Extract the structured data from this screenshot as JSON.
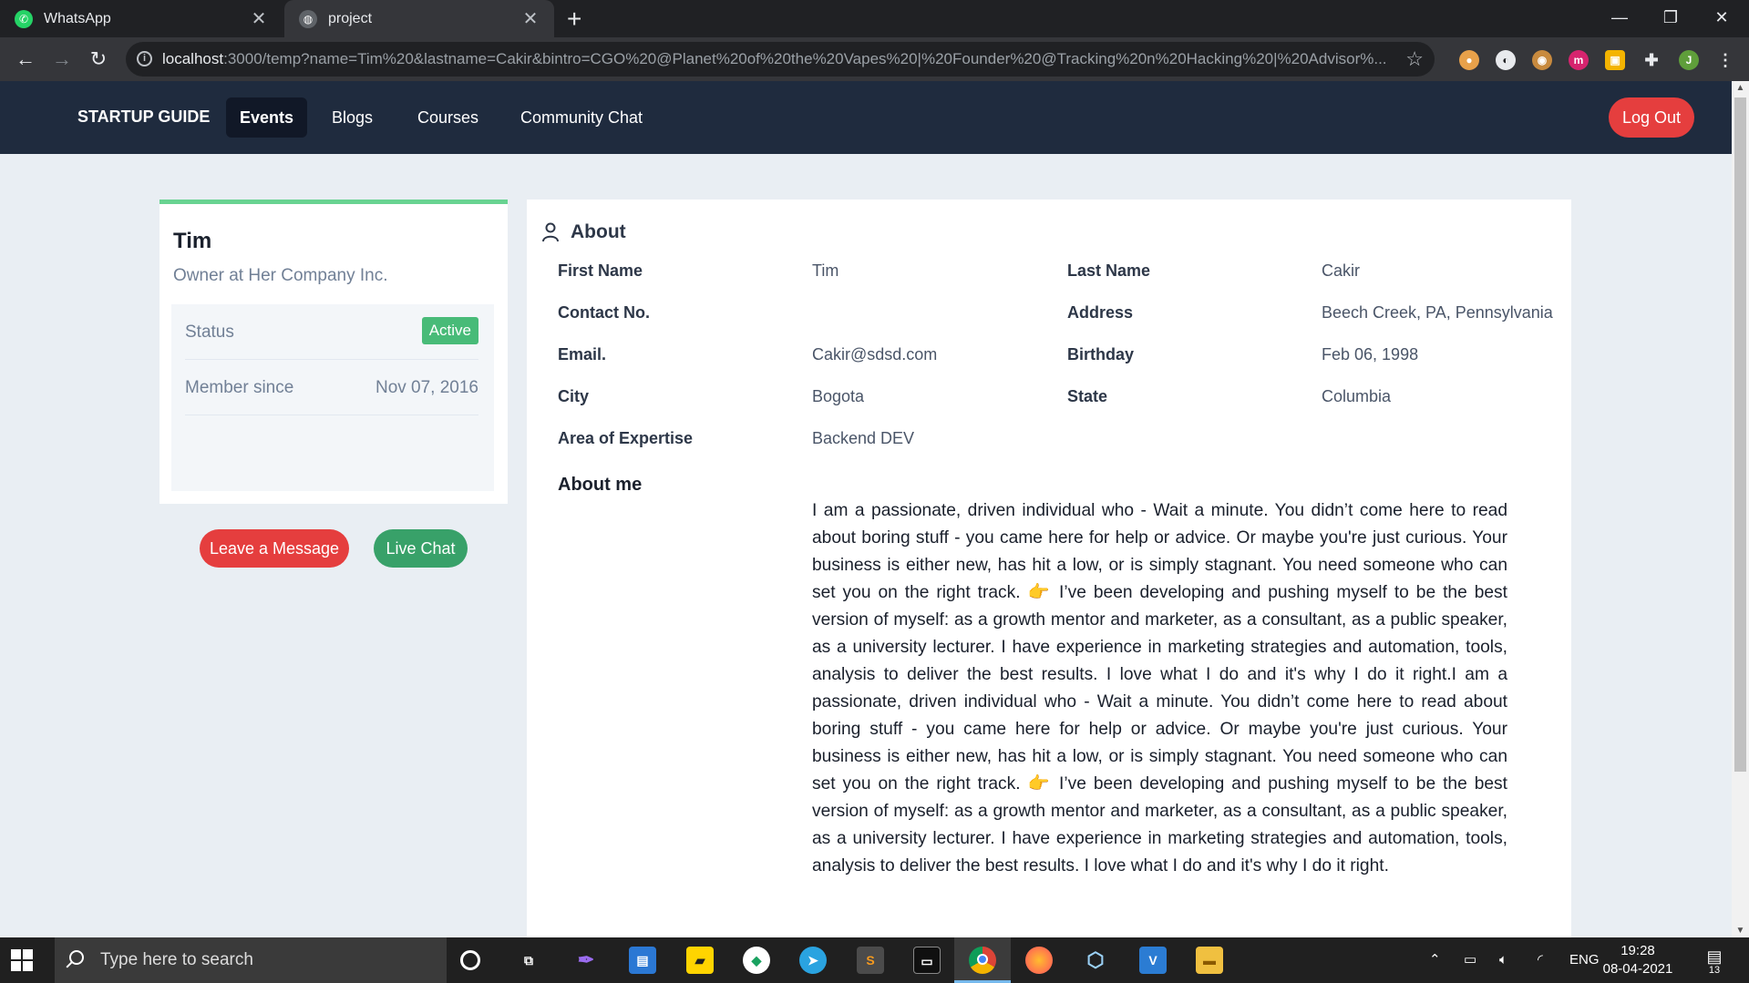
{
  "browser": {
    "tabs": [
      {
        "title": "WhatsApp",
        "icon": "whatsapp-icon"
      },
      {
        "title": "project",
        "icon": "globe-icon"
      }
    ],
    "url_host": "localhost",
    "url_rest": ":3000/temp?name=Tim%20&lastname=Cakir&bintro=CGO%20@Planet%20of%20the%20Vapes%20|%20Founder%20@Tracking%20n%20Hacking%20|%20Advisor%...",
    "profile_initial": "J"
  },
  "nav": {
    "brand": "STARTUP GUIDE",
    "links": [
      "Events",
      "Blogs",
      "Courses",
      "Community Chat"
    ],
    "active_link": "Events",
    "logout": "Log Out"
  },
  "profile": {
    "name": "Tim",
    "role": "Owner at Her Company Inc.",
    "status_label": "Status",
    "status_value": "Active",
    "member_label": "Member since",
    "member_value": "Nov 07, 2016",
    "message_button": "Leave a Message",
    "chat_button": "Live Chat"
  },
  "about": {
    "title": "About",
    "fields": {
      "first_name": {
        "label": "First Name",
        "value": "Tim"
      },
      "last_name": {
        "label": "Last Name",
        "value": "Cakir"
      },
      "contact": {
        "label": "Contact No.",
        "value": ""
      },
      "address": {
        "label": "Address",
        "value": "Beech Creek, PA, Pennsylvania"
      },
      "email": {
        "label": "Email.",
        "value": "Cakir@sdsd.com"
      },
      "birthday": {
        "label": "Birthday",
        "value": "Feb 06, 1998"
      },
      "city": {
        "label": "City",
        "value": "Bogota"
      },
      "state": {
        "label": "State",
        "value": "Columbia"
      },
      "expertise": {
        "label": "Area of Expertise",
        "value": "Backend DEV"
      }
    },
    "about_me_title": "About me",
    "about_me_part1": "I am a passionate, driven individual who - Wait a minute. You didn’t come here to read about boring stuff - you came here for help or advice. Or maybe you're just curious. Your business is either new, has hit a low, or is simply stagnant. You need someone who can set you on the right track.",
    "about_me_part2": "I’ve been developing and pushing myself to be the best version of myself: as a growth mentor and marketer, as a consultant, as a public speaker, as a university lecturer. I have experience in marketing strategies and automation, tools, analysis to deliver the best results. I love what I do and it's why I do it right.I am a passionate, driven individual who - Wait a minute. You didn’t come here to read about boring stuff - you came here for help or advice. Or maybe you're just curious. Your business is either new, has hit a low, or is simply stagnant. You need someone who can set you on the right track.",
    "about_me_part3": "I’ve been developing and pushing myself to be the best version of myself: as a growth mentor and marketer, as a consultant, as a public speaker, as a university lecturer. I have experience in marketing strategies and automation, tools, analysis to deliver the best results. I love what I do and it's why I do it right."
  },
  "taskbar": {
    "search_placeholder": "Type here to search",
    "lang": "ENG",
    "time": "19:28",
    "date": "08-04-2021",
    "notifications": "13"
  },
  "colors": {
    "nav_bg": "#1f2b3e",
    "danger": "#e53e3e",
    "success": "#48bb78",
    "accent_bar": "#68d391"
  }
}
